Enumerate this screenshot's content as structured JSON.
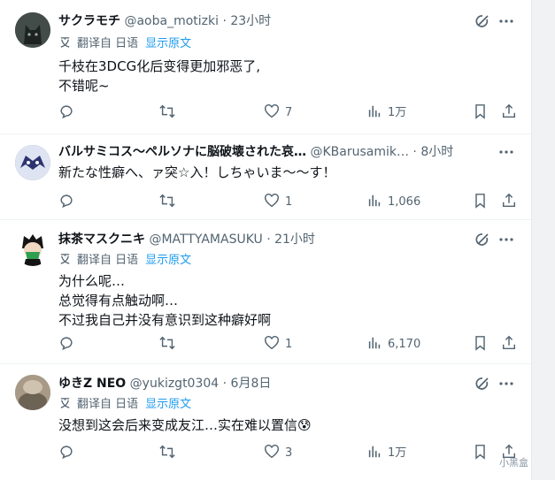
{
  "translate": {
    "label": "翻译自 日语",
    "show_original": "显示原文"
  },
  "tweets": [
    {
      "name": "サクラモチ",
      "handle": "@aoba_motizki",
      "time": "· 23小时",
      "translated": true,
      "lines": [
        "千枝在3DCG化后变得更加邪恶了,",
        "不错呢~"
      ],
      "replies": "",
      "retweets": "",
      "likes": "7",
      "views": "1万",
      "avatar_color": "#3a4340"
    },
    {
      "name": "バルサミコス〜ペルソナに脳破壊された哀…",
      "handle": "@KBarusamik…",
      "time": "· 8小时",
      "translated": false,
      "lines": [
        "新たな性癖へ、ァ突☆入！しちゃいま〜〜す！"
      ],
      "replies": "",
      "retweets": "",
      "likes": "1",
      "views": "1,066",
      "avatar_color": "#6b7fb5"
    },
    {
      "name": "抹茶マスクニキ",
      "handle": "@MATTYAMASUKU",
      "time": "· 21小时",
      "translated": true,
      "lines": [
        "为什么呢…",
        "总觉得有点触动啊…",
        "不过我自己并没有意识到这种癖好啊"
      ],
      "replies": "",
      "retweets": "",
      "likes": "1",
      "views": "6,170",
      "avatar_color": "#1b7a3a"
    },
    {
      "name": "ゆきZ NEO",
      "handle": "@yukizgt0304",
      "time": "· 6月8日",
      "translated": true,
      "lines": [
        "没想到这会后来变成友江…实在难以置信😰"
      ],
      "replies": "",
      "retweets": "",
      "likes": "3",
      "views": "1万",
      "avatar_color": "#8c8070"
    }
  ],
  "watermark": "小黑盒"
}
